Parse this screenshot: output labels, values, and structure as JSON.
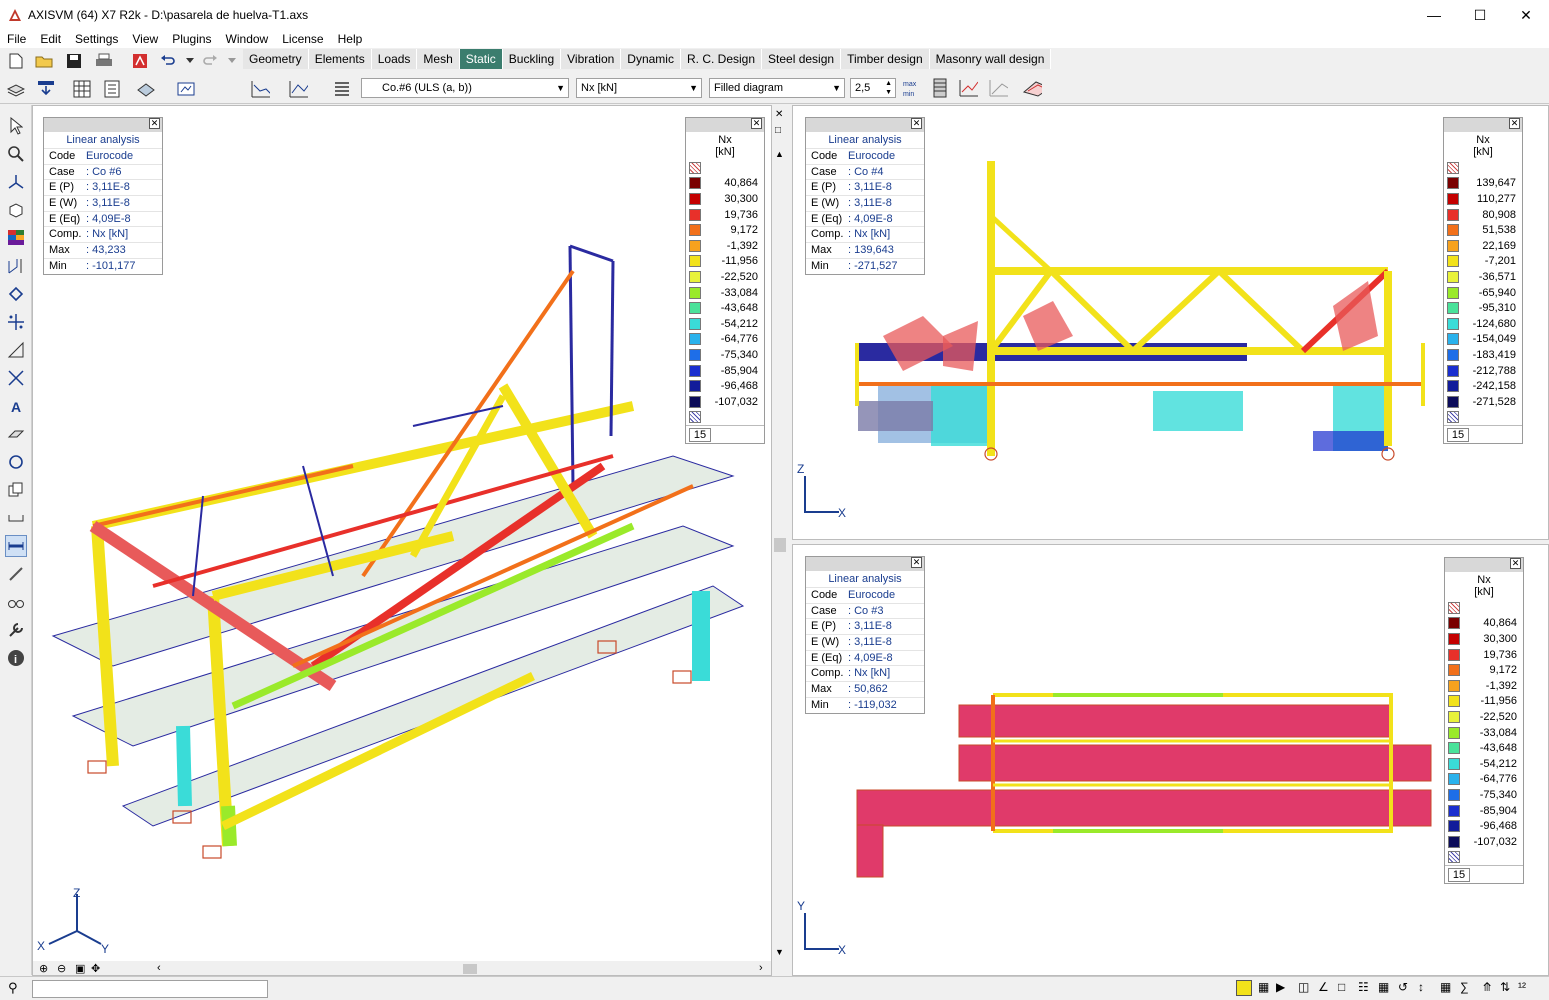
{
  "window": {
    "title": "AXISVM (64) X7 R2k - D:\\pasarela de huelva-T1.axs"
  },
  "menu": [
    "File",
    "Edit",
    "Settings",
    "View",
    "Plugins",
    "Window",
    "License",
    "Help"
  ],
  "tabs": [
    "Geometry",
    "Elements",
    "Loads",
    "Mesh",
    "Static",
    "Buckling",
    "Vibration",
    "Dynamic",
    "R. C. Design",
    "Steel design",
    "Timber design",
    "Masonry wall design"
  ],
  "active_tab": "Static",
  "toolbar": {
    "load_case": "Co.#6 (ULS (a, b))",
    "component": "Nx [kN]",
    "display_mode": "Filled diagram",
    "scale": "2,5"
  },
  "views": [
    {
      "info": {
        "title": "Linear analysis",
        "code_label": "Code",
        "code": "Eurocode",
        "case_label": "Case",
        "case": ": Co #6",
        "ep_label": "E (P)",
        "ep": ": 3,11E-8",
        "ew_label": "E (W)",
        "ew": ": 3,11E-8",
        "eeq_label": "E (Eq)",
        "eeq": ": 4,09E-8",
        "comp_label": "Comp.",
        "comp": ": Nx [kN]",
        "max_label": "Max",
        "max": ": 43,233",
        "min_label": "Min",
        "min": ": -101,177"
      },
      "legend": {
        "title": "Nx",
        "unit": "[kN]",
        "count": "15",
        "values": [
          "40,864",
          "30,300",
          "19,736",
          "9,172",
          "-1,392",
          "-11,956",
          "-22,520",
          "-33,084",
          "-43,648",
          "-54,212",
          "-64,776",
          "-75,340",
          "-85,904",
          "-96,468",
          "-107,032"
        ]
      },
      "axes": {
        "z": "Z",
        "x": "X",
        "y": "Y"
      }
    },
    {
      "info": {
        "title": "Linear analysis",
        "code_label": "Code",
        "code": "Eurocode",
        "case_label": "Case",
        "case": ": Co #4",
        "ep_label": "E (P)",
        "ep": ": 3,11E-8",
        "ew_label": "E (W)",
        "ew": ": 3,11E-8",
        "eeq_label": "E (Eq)",
        "eeq": ": 4,09E-8",
        "comp_label": "Comp.",
        "comp": ": Nx [kN]",
        "max_label": "Max",
        "max": ": 139,643",
        "min_label": "Min",
        "min": ": -271,527"
      },
      "legend": {
        "title": "Nx",
        "unit": "[kN]",
        "count": "15",
        "values": [
          "139,647",
          "110,277",
          "80,908",
          "51,538",
          "22,169",
          "-7,201",
          "-36,571",
          "-65,940",
          "-95,310",
          "-124,680",
          "-154,049",
          "-183,419",
          "-212,788",
          "-242,158",
          "-271,528"
        ]
      },
      "axes": {
        "z": "Z",
        "x": "X"
      }
    },
    {
      "info": {
        "title": "Linear analysis",
        "code_label": "Code",
        "code": "Eurocode",
        "case_label": "Case",
        "case": ": Co #3",
        "ep_label": "E (P)",
        "ep": ": 3,11E-8",
        "ew_label": "E (W)",
        "ew": ": 3,11E-8",
        "eeq_label": "E (Eq)",
        "eeq": ": 4,09E-8",
        "comp_label": "Comp.",
        "comp": ": Nx [kN]",
        "max_label": "Max",
        "max": ": 50,862",
        "min_label": "Min",
        "min": ": -119,032"
      },
      "legend": {
        "title": "Nx",
        "unit": "[kN]",
        "count": "15",
        "values": [
          "40,864",
          "30,300",
          "19,736",
          "9,172",
          "-1,392",
          "-11,956",
          "-22,520",
          "-33,084",
          "-43,648",
          "-54,212",
          "-64,776",
          "-75,340",
          "-85,904",
          "-96,468",
          "-107,032"
        ]
      },
      "axes": {
        "y": "Y",
        "x": "X"
      }
    }
  ],
  "legend_colors": [
    "#7a0000",
    "#c40000",
    "#e8302a",
    "#f2701a",
    "#f7a21e",
    "#f2e21a",
    "#e8f23a",
    "#9aea2a",
    "#4ae29a",
    "#3adcd8",
    "#2ab2ec",
    "#1e6ee8",
    "#1a2ecf",
    "#121c9a",
    "#0c0c5a"
  ]
}
